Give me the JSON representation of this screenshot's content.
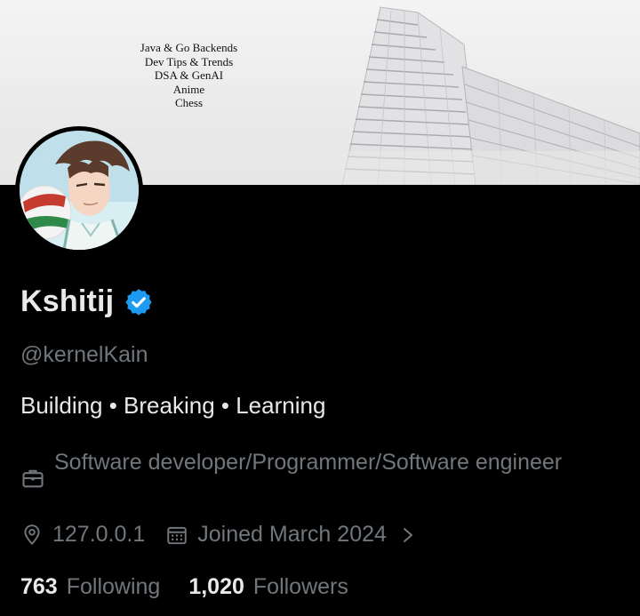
{
  "banner": {
    "lines": [
      "Java & Go Backends",
      "Dev Tips & Trends",
      "DSA & GenAI",
      "Anime",
      "Chess"
    ]
  },
  "profile": {
    "name": "Kshitij",
    "handle": "@kernelKain",
    "bio": "Building • Breaking • Learning",
    "profession": "Software developer/Programmer/Software engineer",
    "location": "127.0.0.1",
    "joined": "Joined March 2024",
    "following_count": "763",
    "following_label": "Following",
    "followers_count": "1,020",
    "followers_label": "Followers"
  },
  "icons": {
    "verified": "verified-badge-icon",
    "profession": "briefcase-icon",
    "location": "location-pin-icon",
    "joined": "calendar-icon",
    "more": "chevron-right-icon"
  },
  "colors": {
    "background": "#000000",
    "primary_text": "#e7e9ea",
    "secondary_text": "#71767b",
    "verified_blue": "#1d9bf0"
  }
}
